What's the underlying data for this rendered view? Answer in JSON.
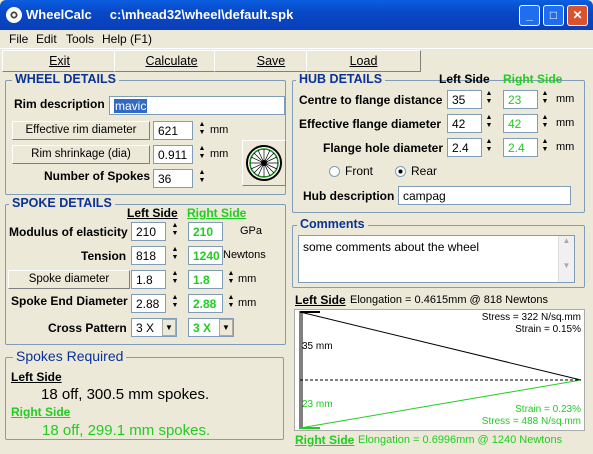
{
  "window": {
    "title": "WheelCalc     c:\\mhead32\\wheel\\default.spk"
  },
  "controls": {
    "minimize": "_",
    "maximize": "□",
    "close": "✕"
  },
  "menu": [
    "File",
    "Edit",
    "Tools",
    "Help (F1)"
  ],
  "toolbar": {
    "exit": "Exit",
    "calculate": "Calculate",
    "save": "Save",
    "load": "Load"
  },
  "wheel": {
    "title": "WHEEL DETAILS",
    "rim_description_label": "Rim description",
    "rim_description": "mavic",
    "effective_rim_diameter_button": "Effective rim diameter",
    "effective_rim_diameter": "621",
    "rim_shrinkage_button": "Rim shrinkage (dia)",
    "rim_shrinkage": "0.911",
    "num_spokes_label": "Number of Spokes",
    "num_spokes": "36",
    "unit_mm": "mm"
  },
  "spoke": {
    "title": "SPOKE DETAILS",
    "left_side": "Left Side",
    "right_side": "Right Side",
    "modulus_label": "Modulus of elasticity",
    "modulus_left": "210",
    "modulus_right": "210",
    "modulus_unit": "GPa",
    "tension_label": "Tension",
    "tension_left": "818",
    "tension_right": "1240",
    "tension_unit": "Newtons",
    "spoke_diameter_button": "Spoke diameter",
    "spoke_diameter_left": "1.8",
    "spoke_diameter_right": "1.8",
    "end_diameter_label": "Spoke End Diameter",
    "end_diameter_left": "2.88",
    "end_diameter_right": "2.88",
    "cross_label": "Cross Pattern",
    "cross_left": "3 X",
    "cross_right": "3 X",
    "unit_mm": "mm"
  },
  "required": {
    "title": "Spokes Required",
    "left_label": "Left Side",
    "left_text": "18 off, 300.5 mm spokes.",
    "right_label": "Right Side",
    "right_text": "18 off, 299.1 mm spokes."
  },
  "hub": {
    "title": "HUB DETAILS",
    "left_side": "Left Side",
    "right_side": "Right Side",
    "centre_label": "Centre to flange distance",
    "centre_left": "35",
    "centre_right": "23",
    "eff_flange_label": "Effective flange diameter",
    "eff_flange_left": "42",
    "eff_flange_right": "42",
    "hole_label": "Flange hole diameter",
    "hole_left": "2.4",
    "hole_right": "2.4",
    "front_label": "Front",
    "rear_label": "Rear",
    "hub_desc_label": "Hub description",
    "hub_desc": "campag",
    "unit_mm": "mm"
  },
  "comments": {
    "title": "Comments",
    "text": "some comments about the wheel"
  },
  "diagram": {
    "left_header": "Left Side",
    "left_elongation": "Elongation = 0.4615mm @ 818 Newtons",
    "right_header": "Right Side",
    "right_elongation": "Elongation = 0.6996mm @ 1240 Newtons",
    "stress_left": "Stress = 322 N/sq.mm",
    "strain_left": "Strain = 0.15%",
    "strain_right": "Strain = 0.23%",
    "stress_right": "Stress = 488 N/sq.mm",
    "left_dim": "35 mm",
    "right_dim": "23 mm",
    "left_color": "#000000",
    "right_color": "#22cc22"
  }
}
